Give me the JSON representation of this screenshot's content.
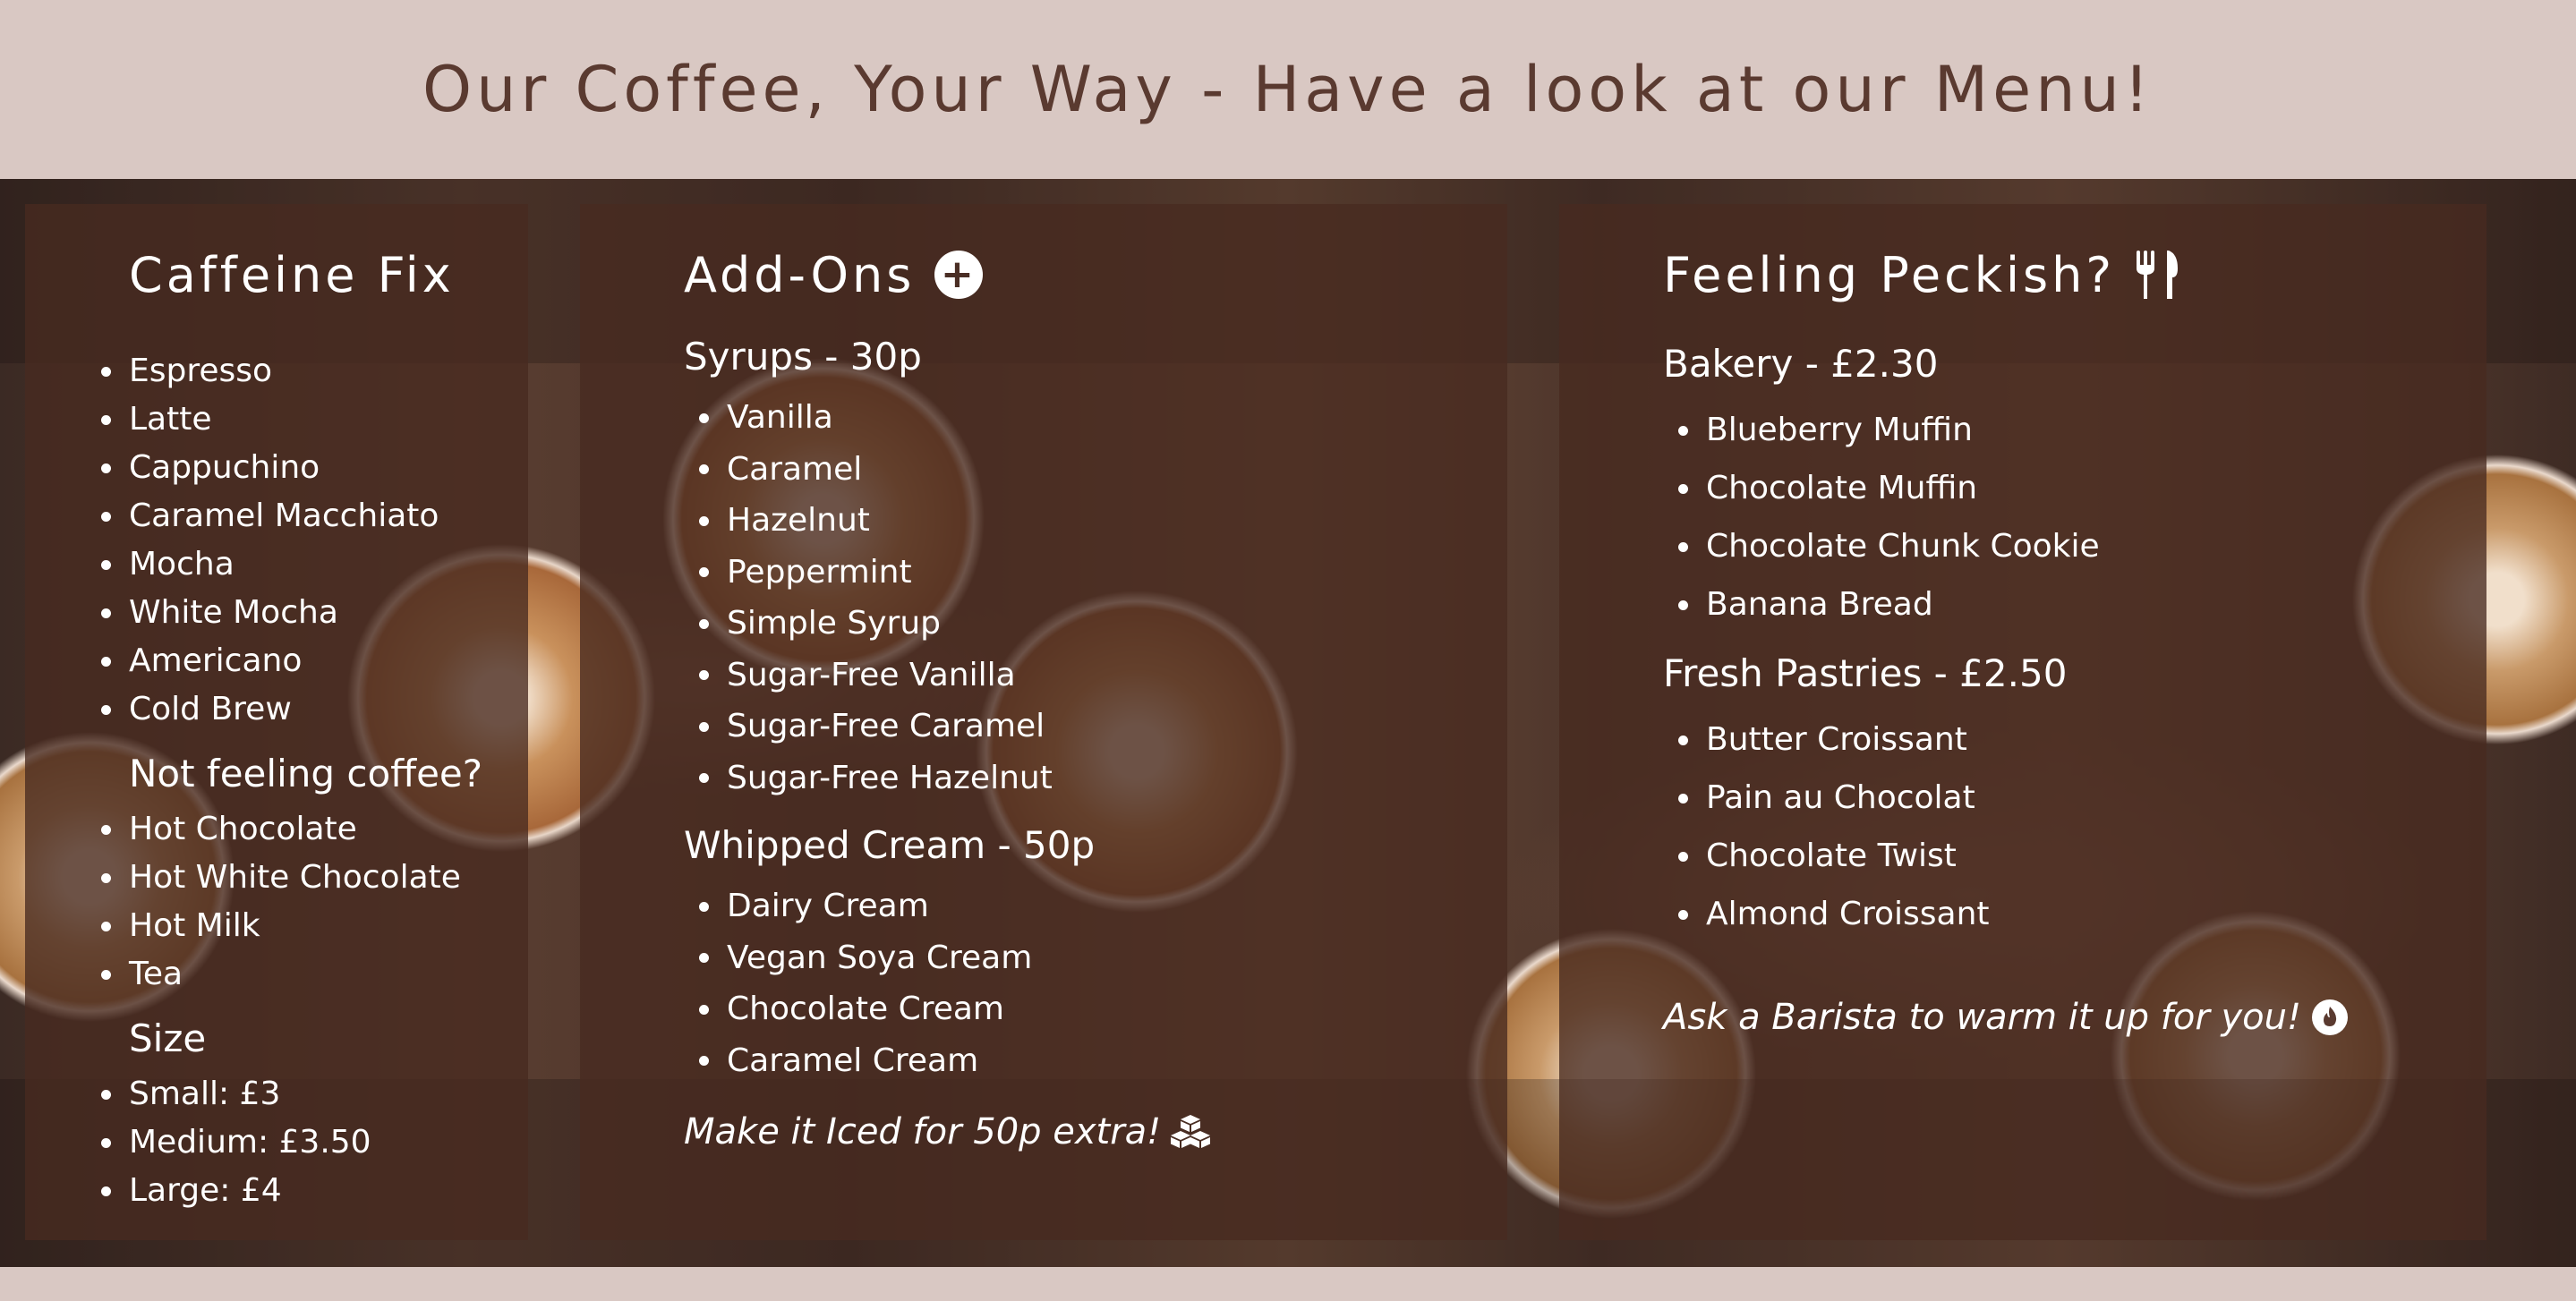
{
  "header": {
    "title": "Our Coffee, Your Way - Have a look at our Menu!"
  },
  "colors": {
    "header_bg": "#d9c8c3",
    "title_text": "#5a3a30",
    "card_bg": "rgba(72, 42, 32, 0.78)",
    "card_text": "#ffffff"
  },
  "caffeine": {
    "title": "Caffeine Fix",
    "coffee_items": [
      "Espresso",
      "Latte",
      "Cappuchino",
      "Caramel Macchiato",
      "Mocha",
      "White Mocha",
      "Americano",
      "Cold Brew"
    ],
    "alt_heading": "Not feeling coffee?",
    "alt_items": [
      "Hot Chocolate",
      "Hot White Chocolate",
      "Hot Milk",
      "Tea"
    ],
    "size_heading": "Size",
    "size_items": [
      "Small: £3",
      "Medium: £3.50",
      "Large: £4"
    ]
  },
  "addons": {
    "title": "Add-Ons",
    "title_icon": "plus-circle-icon",
    "syrups_heading": "Syrups - 30p",
    "syrups": [
      "Vanilla",
      "Caramel",
      "Hazelnut",
      "Peppermint",
      "Simple Syrup",
      "Sugar-Free Vanilla",
      "Sugar-Free Caramel",
      "Sugar-Free Hazelnut"
    ],
    "cream_heading": "Whipped Cream - 50p",
    "creams": [
      "Dairy Cream",
      "Vegan Soya Cream",
      "Chocolate Cream",
      "Caramel Cream"
    ],
    "iced_note": "Make it Iced for 50p extra!",
    "iced_icon": "ice-cubes-icon"
  },
  "peckish": {
    "title": "Feeling Peckish?",
    "title_icon": "fork-knife-icon",
    "bakery_heading": "Bakery - £2.30",
    "bakery": [
      "Blueberry Muffin",
      "Chocolate Muffin",
      "Chocolate Chunk Cookie",
      "Banana Bread"
    ],
    "pastries_heading": "Fresh Pastries - £2.50",
    "pastries": [
      "Butter Croissant",
      "Pain au Chocolat",
      "Chocolate Twist",
      "Almond Croissant"
    ],
    "warm_note": "Ask a Barista to warm it up for you!",
    "warm_icon": "fire-icon"
  }
}
